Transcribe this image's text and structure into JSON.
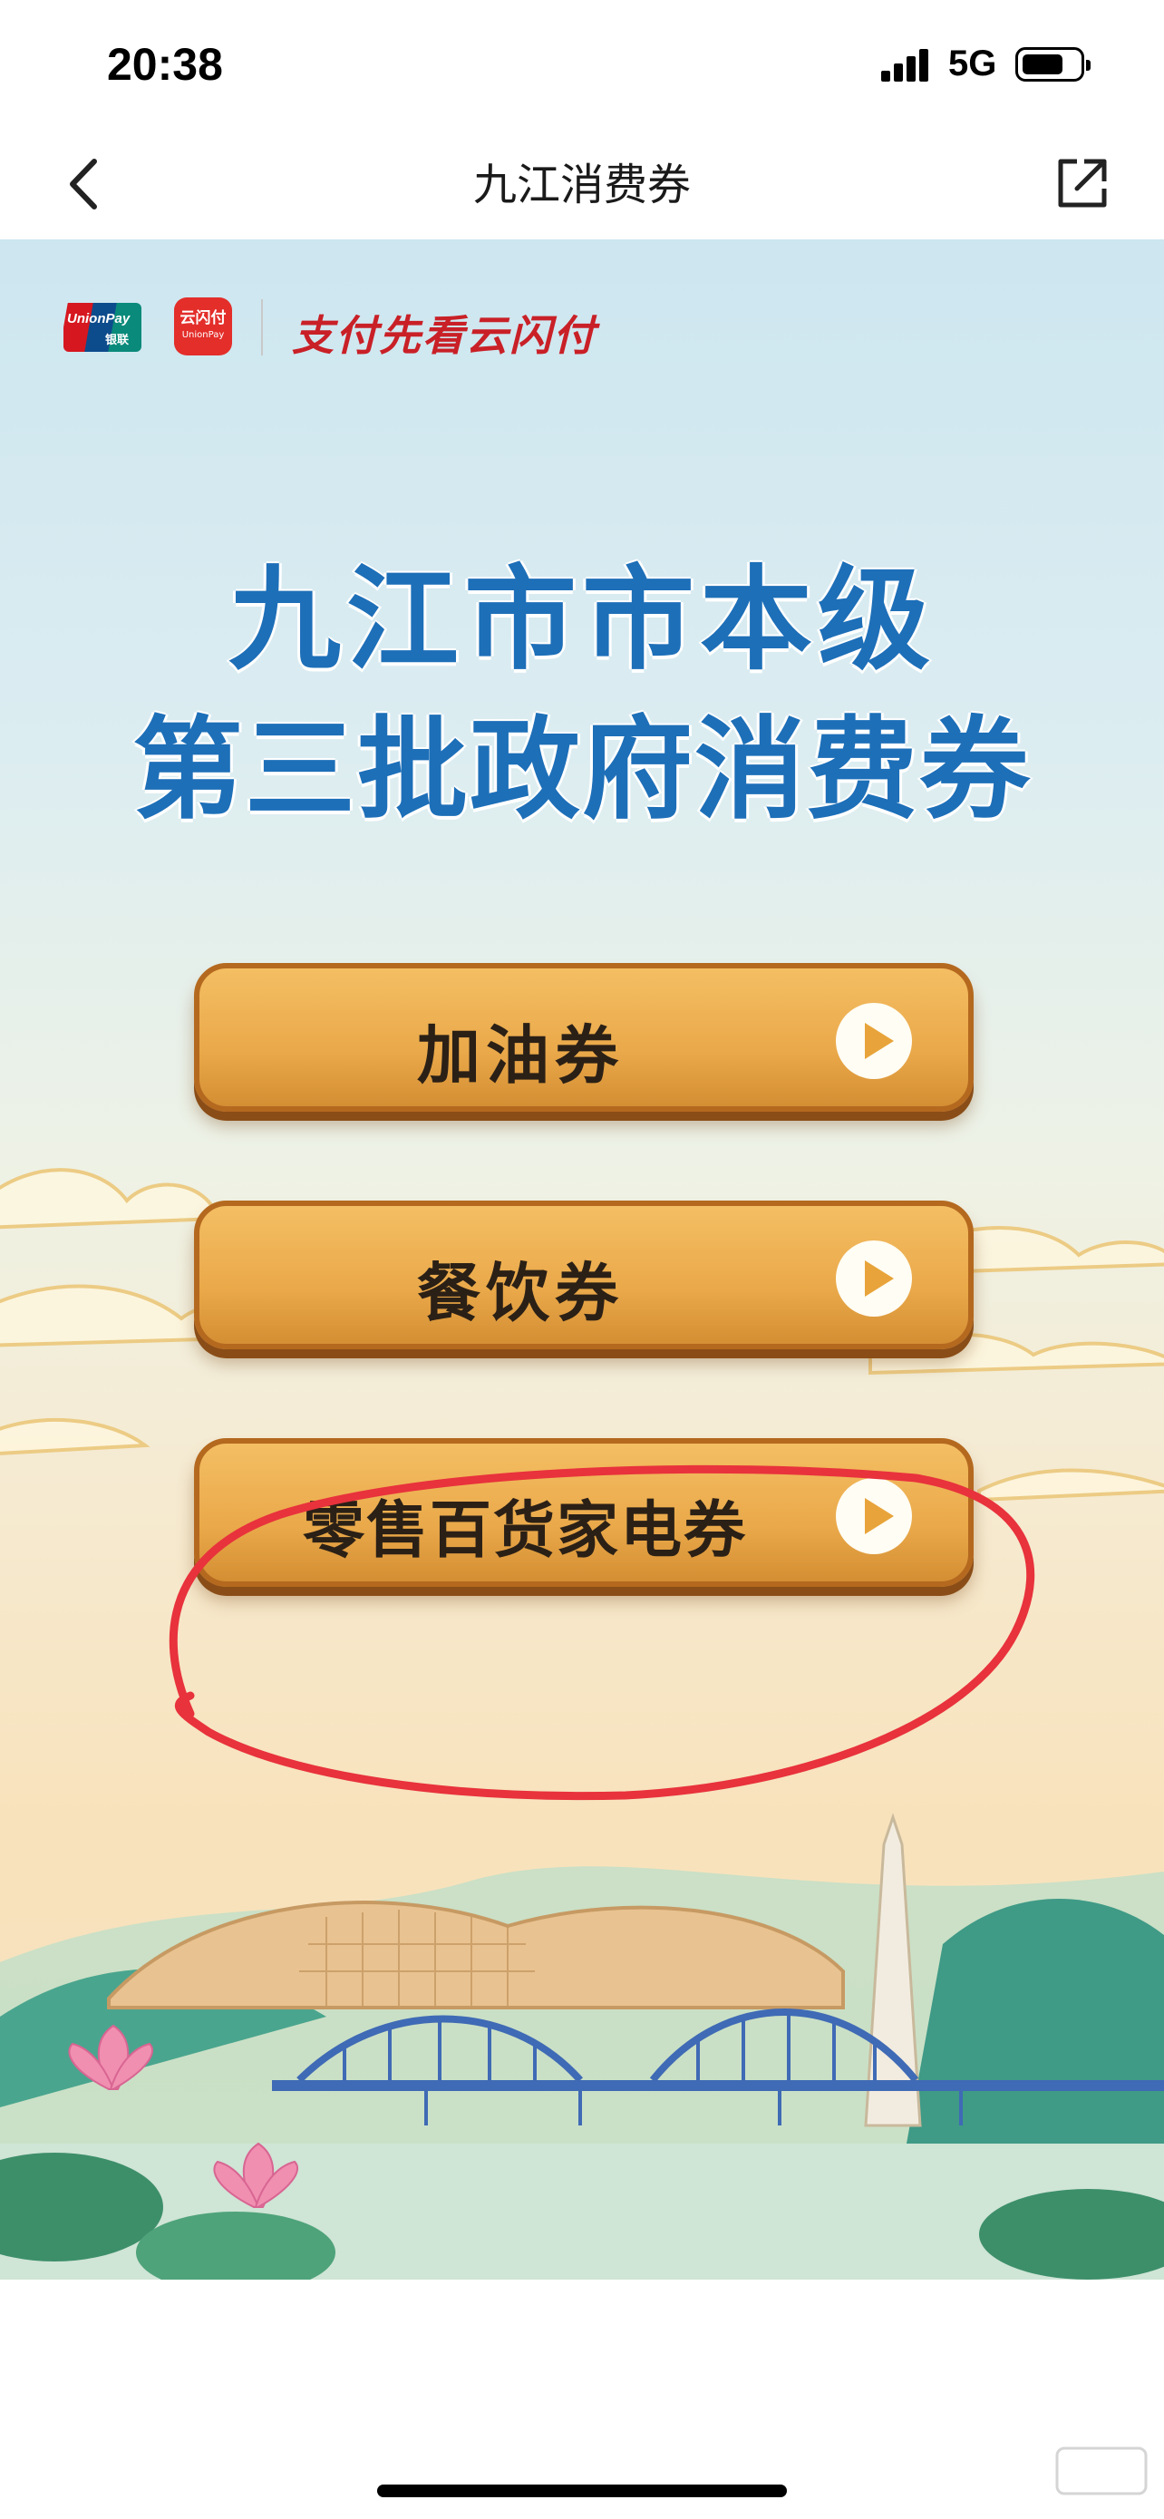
{
  "status_bar": {
    "time": "20:38",
    "network": "5G",
    "icons": [
      "signal-icon",
      "battery-icon"
    ]
  },
  "nav": {
    "title": "九江消费券",
    "back_icon": "chevron-left-icon",
    "share_icon": "share-icon"
  },
  "banner": {
    "unionpay_text_en": "UnionPay",
    "unionpay_text_cn": "银联",
    "app_name": "云闪付",
    "slogan": "支付先看云闪付",
    "headline_line1": "九江市市本级",
    "headline_line2": "第三批政府消费券"
  },
  "vouchers": [
    {
      "label": "加油券"
    },
    {
      "label": "餐饮券"
    },
    {
      "label": "零售百货家电券"
    }
  ],
  "colors": {
    "headline": "#1d6fb8",
    "button": "#eaa94a",
    "slogan": "#c92027",
    "annotation": "#e8323c"
  }
}
